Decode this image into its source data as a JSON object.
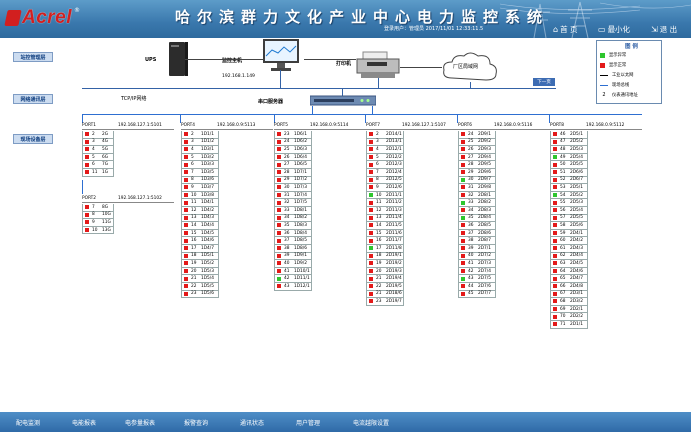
{
  "header": {
    "brand": "Acrel",
    "reg": "®",
    "title": "哈尔滨群力文化产业中心电力监控系统",
    "user_line": "登录用户：管理员    2017/11/01    12:33:11.5",
    "buttons": [
      {
        "icon": "home-icon",
        "label": "首 页"
      },
      {
        "icon": "minimize-icon",
        "label": "最小化"
      },
      {
        "icon": "exit-icon",
        "label": "退 出"
      }
    ]
  },
  "levels": {
    "station": "站控管理层",
    "network": "网络通讯层",
    "field": "现场设备层"
  },
  "topology": {
    "ups": "UPS",
    "host": "监控主机",
    "host_ip": "192.168.1.149",
    "printer": "打印机",
    "lan": "厂区局域网",
    "next": "下一页",
    "tcpip": "TCP/IP网络",
    "serial_server": "串口服务器"
  },
  "legend": {
    "title": "图 例",
    "items": [
      {
        "color": "#2ec62e",
        "label": "显示异常"
      },
      {
        "color": "#e31a1a",
        "label": "显示正常"
      },
      {
        "color": "#000000",
        "label": "工业以太网"
      },
      {
        "color": "#2e6fd1",
        "label": "现场总线"
      },
      {
        "color": "",
        "label": "仪表通讯地址",
        "mark": "2"
      }
    ]
  },
  "ports": [
    {
      "id": "p1",
      "port": "PORT1",
      "ip": "192.168.127.1:5101",
      "rows": [
        [
          "2",
          "2G",
          "r"
        ],
        [
          "3",
          "4G",
          "r"
        ],
        [
          "4",
          "5G",
          "r"
        ],
        [
          "5",
          "6G",
          "r"
        ],
        [
          "6",
          "7G",
          "r"
        ],
        [
          "11",
          "1G",
          "r"
        ]
      ]
    },
    {
      "id": "p1b",
      "port": "PORT2",
      "ip": "192.168.127.1:5102",
      "rows": [
        [
          "7",
          "8G",
          "r"
        ],
        [
          "8",
          "10G",
          "r"
        ],
        [
          "9",
          "11G",
          "r"
        ],
        [
          "10",
          "13G",
          "r"
        ]
      ]
    },
    {
      "id": "p2",
      "port": "PORT4",
      "ip": "192.168.0.9:5113",
      "rows": [
        [
          "2",
          "1D1/1",
          "r"
        ],
        [
          "3",
          "1D1/2",
          "r"
        ],
        [
          "4",
          "1D3/1",
          "r"
        ],
        [
          "5",
          "1D3/2",
          "r"
        ],
        [
          "6",
          "1D3/3",
          "r"
        ],
        [
          "7",
          "1D3/5",
          "r"
        ],
        [
          "8",
          "1D3/6",
          "r"
        ],
        [
          "9",
          "1D3/7",
          "r"
        ],
        [
          "10",
          "1D3/8",
          "r"
        ],
        [
          "11",
          "1D4/1",
          "r"
        ],
        [
          "12",
          "1D4/2",
          "r"
        ],
        [
          "13",
          "1D4/3",
          "r"
        ],
        [
          "14",
          "1D4/4",
          "r"
        ],
        [
          "15",
          "1D4/5",
          "r"
        ],
        [
          "16",
          "1D4/6",
          "r"
        ],
        [
          "17",
          "1D4/7",
          "r"
        ],
        [
          "18",
          "1D5/1",
          "r"
        ],
        [
          "19",
          "1D5/2",
          "r"
        ],
        [
          "20",
          "1D5/3",
          "r"
        ],
        [
          "21",
          "1D5/4",
          "r"
        ],
        [
          "22",
          "1D5/5",
          "r"
        ],
        [
          "23",
          "1D5/6",
          "r"
        ]
      ]
    },
    {
      "id": "p3",
      "port": "PORT5",
      "ip": "192.168.0.9:5114",
      "rows": [
        [
          "23",
          "1D6/1",
          "r"
        ],
        [
          "24",
          "1D6/2",
          "r"
        ],
        [
          "25",
          "1D6/3",
          "r"
        ],
        [
          "26",
          "1D6/4",
          "r"
        ],
        [
          "27",
          "1D6/5",
          "r"
        ],
        [
          "28",
          "1D7/1",
          "r"
        ],
        [
          "29",
          "1D7/2",
          "r"
        ],
        [
          "30",
          "1D7/3",
          "r"
        ],
        [
          "31",
          "1D7/4",
          "r"
        ],
        [
          "32",
          "1D7/5",
          "r"
        ],
        [
          "33",
          "1D8/1",
          "r"
        ],
        [
          "34",
          "1D8/2",
          "r"
        ],
        [
          "35",
          "1D8/3",
          "r"
        ],
        [
          "36",
          "1D8/4",
          "r"
        ],
        [
          "37",
          "1D8/5",
          "r"
        ],
        [
          "38",
          "1D8/6",
          "r"
        ],
        [
          "39",
          "1D9/1",
          "r"
        ],
        [
          "40",
          "1D9/2",
          "r"
        ],
        [
          "41",
          "1D10/1",
          "r"
        ],
        [
          "42",
          "1D11/1",
          "g"
        ],
        [
          "43",
          "1D12/1",
          "r"
        ]
      ]
    },
    {
      "id": "p4",
      "port": "PORT7",
      "ip": "192.168.127.1:5107",
      "rows": [
        [
          "2",
          "2D14/1",
          "r"
        ],
        [
          "3",
          "2D13/1",
          "r"
        ],
        [
          "4",
          "2D12/1",
          "r"
        ],
        [
          "5",
          "2D12/2",
          "r"
        ],
        [
          "6",
          "2D12/3",
          "r"
        ],
        [
          "7",
          "2D12/4",
          "r"
        ],
        [
          "8",
          "2D12/5",
          "r"
        ],
        [
          "9",
          "2D12/6",
          "r"
        ],
        [
          "10",
          "2D11/1",
          "g"
        ],
        [
          "11",
          "2D11/2",
          "r"
        ],
        [
          "12",
          "2D11/3",
          "r"
        ],
        [
          "13",
          "2D11/4",
          "r"
        ],
        [
          "14",
          "2D11/5",
          "r"
        ],
        [
          "15",
          "2D11/6",
          "r"
        ],
        [
          "16",
          "2D11/7",
          "r"
        ],
        [
          "17",
          "2D11/8",
          "g"
        ],
        [
          "18",
          "2D19/1",
          "r"
        ],
        [
          "19",
          "2D19/2",
          "r"
        ],
        [
          "20",
          "2D19/3",
          "r"
        ],
        [
          "21",
          "2D19/4",
          "r"
        ],
        [
          "22",
          "2D19/5",
          "r"
        ],
        [
          "21",
          "2D18/6",
          "r"
        ],
        [
          "23",
          "2D19/7",
          "r"
        ]
      ]
    },
    {
      "id": "p5",
      "port": "PORT6",
      "ip": "192.168.0.9:5116",
      "rows": [
        [
          "24",
          "2D9/1",
          "r"
        ],
        [
          "25",
          "2D9/2",
          "r"
        ],
        [
          "26",
          "2D9/3",
          "r"
        ],
        [
          "27",
          "2D9/4",
          "r"
        ],
        [
          "28",
          "2D9/5",
          "r"
        ],
        [
          "29",
          "2D9/6",
          "r"
        ],
        [
          "30",
          "2D9/7",
          "g"
        ],
        [
          "31",
          "2D9/8",
          "r"
        ],
        [
          "32",
          "2D8/1",
          "r"
        ],
        [
          "33",
          "2D8/2",
          "g"
        ],
        [
          "34",
          "2D8/3",
          "r"
        ],
        [
          "35",
          "2D8/4",
          "g"
        ],
        [
          "36",
          "2D8/5",
          "r"
        ],
        [
          "37",
          "2D8/6",
          "r"
        ],
        [
          "38",
          "2D8/7",
          "r"
        ],
        [
          "39",
          "2D7/1",
          "r"
        ],
        [
          "40",
          "2D7/2",
          "r"
        ],
        [
          "41",
          "2D7/3",
          "r"
        ],
        [
          "42",
          "2D7/4",
          "r"
        ],
        [
          "43",
          "2D7/5",
          "g"
        ],
        [
          "44",
          "2D7/6",
          "r"
        ],
        [
          "45",
          "2D7/7",
          "r"
        ]
      ]
    },
    {
      "id": "p6",
      "port": "PORT8",
      "ip": "192.168.0.9:5112",
      "rows": [
        [
          "46",
          "2D5/1",
          "r"
        ],
        [
          "47",
          "2D5/2",
          "r"
        ],
        [
          "48",
          "2D5/3",
          "r"
        ],
        [
          "49",
          "2D5/4",
          "g"
        ],
        [
          "50",
          "2D5/5",
          "r"
        ],
        [
          "51",
          "2D6/6",
          "r"
        ],
        [
          "52",
          "2D6/7",
          "r"
        ],
        [
          "53",
          "2D5/1",
          "r"
        ],
        [
          "54",
          "2D5/2",
          "g"
        ],
        [
          "55",
          "2D5/3",
          "r"
        ],
        [
          "56",
          "2D5/4",
          "r"
        ],
        [
          "57",
          "2D5/5",
          "r"
        ],
        [
          "58",
          "2D5/6",
          "r"
        ],
        [
          "59",
          "2D4/1",
          "r"
        ],
        [
          "60",
          "2D4/2",
          "r"
        ],
        [
          "61",
          "2D4/3",
          "r"
        ],
        [
          "62",
          "2D4/4",
          "r"
        ],
        [
          "63",
          "2D4/5",
          "r"
        ],
        [
          "64",
          "2D4/6",
          "r"
        ],
        [
          "65",
          "2D4/7",
          "r"
        ],
        [
          "66",
          "2D4/8",
          "r"
        ],
        [
          "67",
          "2D3/1",
          "r"
        ],
        [
          "68",
          "2D3/2",
          "r"
        ],
        [
          "69",
          "2D2/1",
          "r"
        ],
        [
          "70",
          "2D2/2",
          "r"
        ],
        [
          "71",
          "2D1/1",
          "r"
        ]
      ]
    }
  ],
  "footer": {
    "items": [
      "配电监测",
      "电能报表",
      "电参量报表",
      "报警查询",
      "通讯状态",
      "用户管理",
      "电流越限设置"
    ]
  }
}
